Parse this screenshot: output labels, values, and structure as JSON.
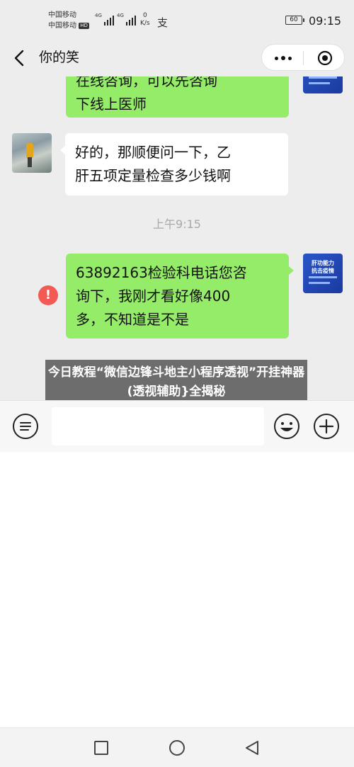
{
  "status_bar": {
    "carrier_1": "中国移动",
    "carrier_2": "中国移动",
    "hd": "HD",
    "network_1": "4G",
    "network_2": "4G",
    "speed_value": "0",
    "speed_unit": "K/s",
    "battery": "60",
    "time": "09:15"
  },
  "nav": {
    "title": "你的笑",
    "icons": [
      "back-arrow-icon",
      "more-icon",
      "target-icon"
    ]
  },
  "messages": [
    {
      "side": "out",
      "text": "在线咨询，可以先咨询\n下线上医师"
    },
    {
      "side": "in",
      "text": "好的，那顺便问一下，乙\n肝五项定量检查多少钱啊"
    },
    {
      "timestamp": "上午9:15"
    },
    {
      "side": "out",
      "text": "63892163检验科电话您咨\n询下，我刚才看好像400\n多，不知道是不是",
      "failed": true
    }
  ],
  "avatar_text": "肝功能力\n抗击疫情",
  "overlay_caption": "今日教程“微信边锋斗地主小程序透视”开挂神器(透视辅助}全揭秘",
  "input_bar": {
    "placeholder": "",
    "icons": [
      "voice-icon",
      "emoji-icon",
      "plus-icon"
    ]
  },
  "colors": {
    "chat_background": "#ededed",
    "sent_bubble": "#95ec69",
    "received_bubble": "#ffffff",
    "error": "#f25a53"
  }
}
